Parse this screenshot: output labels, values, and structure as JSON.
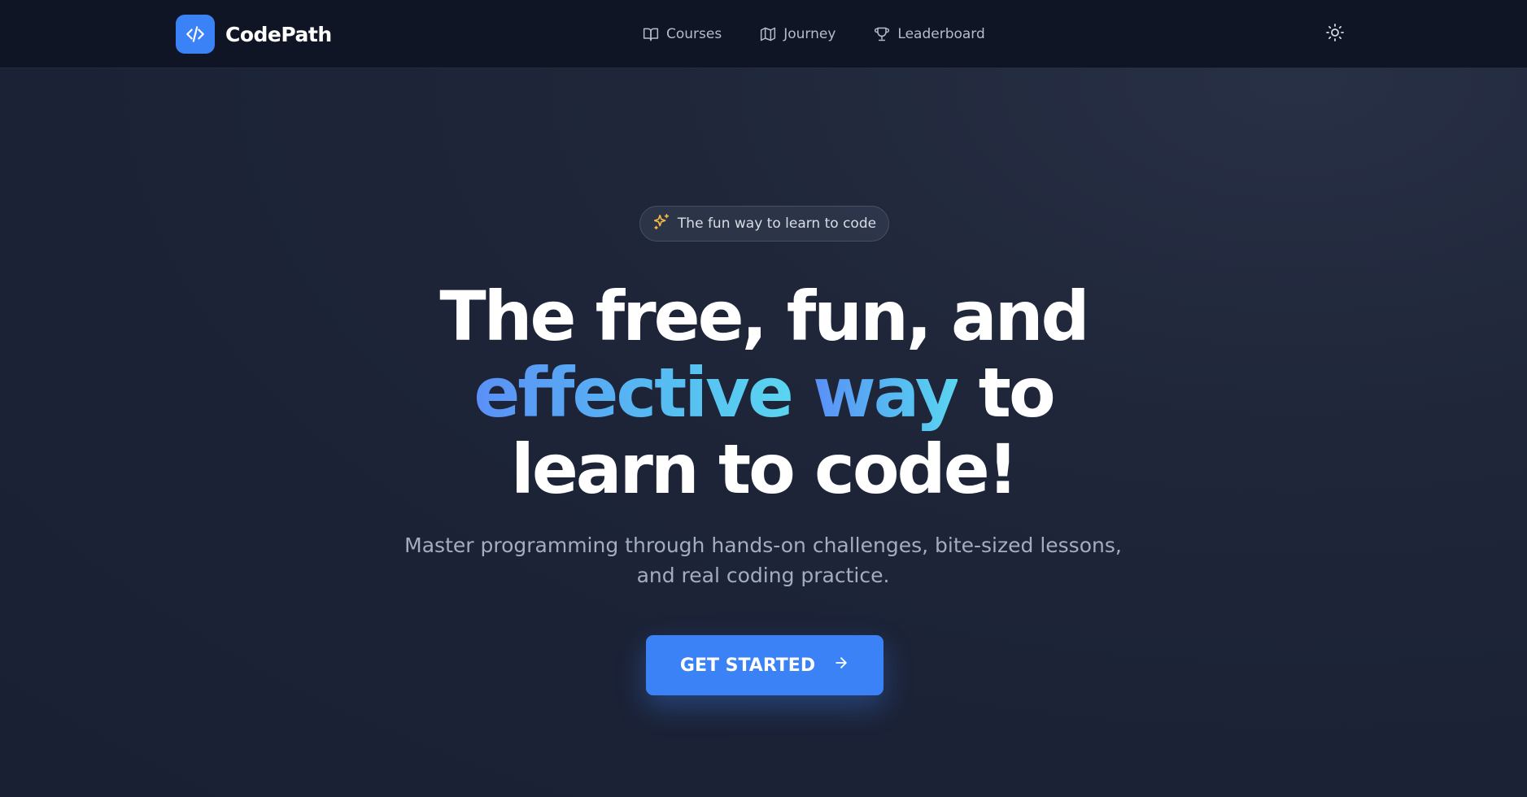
{
  "colors": {
    "accent": "#3b82f6",
    "navbar_bg": "#0f1524",
    "page_bg": "#1c2337",
    "sparkle": "#f5b945",
    "gradient_start": "#5b8ff7",
    "gradient_end": "#5ad5f0"
  },
  "header": {
    "brand_name": "CodePath",
    "brand_icon": "code-brackets-icon",
    "nav": [
      {
        "label": "Courses",
        "icon": "book-icon"
      },
      {
        "label": "Journey",
        "icon": "map-icon"
      },
      {
        "label": "Leaderboard",
        "icon": "trophy-icon"
      }
    ],
    "theme_icon": "sun-icon"
  },
  "hero": {
    "badge": {
      "text": "The fun way to learn to code",
      "icon": "sparkles-icon"
    },
    "headline": {
      "line1": "The free, fun, and",
      "highlight_1": "effective",
      "highlight_2": "way",
      "line2_rest": "to",
      "line3": "learn to code!"
    },
    "subheadline": "Master programming through hands-on challenges, bite-sized lessons, and real coding practice.",
    "cta": {
      "label": "GET STARTED",
      "icon": "arrow-right-icon"
    }
  }
}
